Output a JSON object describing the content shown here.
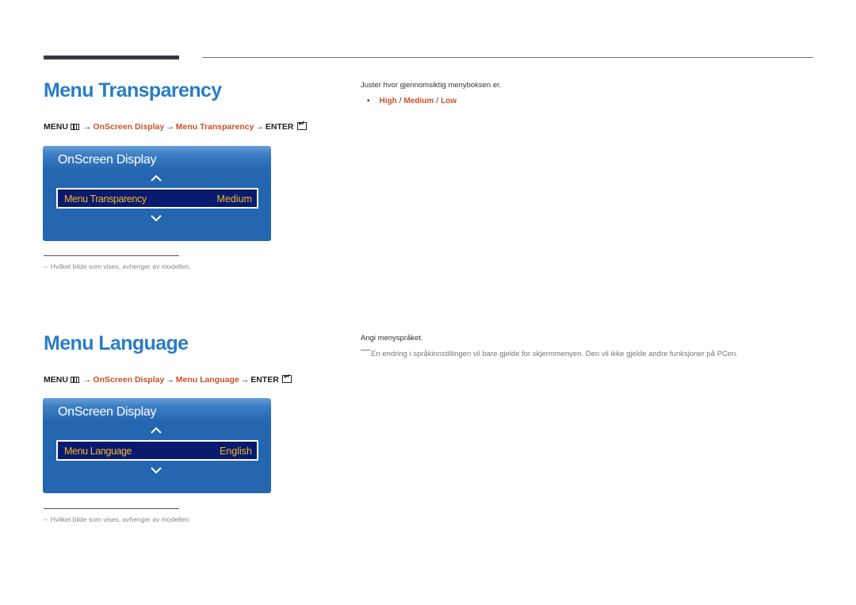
{
  "sections": [
    {
      "title": "Menu Transparency",
      "breadcrumb": {
        "menu": "MENU",
        "path1": "OnScreen Display",
        "path2": "Menu Transparency",
        "enter": "ENTER",
        "arrow": "→"
      },
      "osd": {
        "title": "OnScreen Display",
        "row_label": "Menu Transparency",
        "row_value": "Medium"
      },
      "footnote": "Hvilket bilde som vises, avhenger av modellen.",
      "description": "Juster hvor gjennomsiktig menyboksen er.",
      "options": [
        "High",
        "Medium",
        "Low"
      ],
      "bullet": "•",
      "sep": "/"
    },
    {
      "title": "Menu Language",
      "breadcrumb": {
        "menu": "MENU",
        "path1": "OnScreen Display",
        "path2": "Menu Language",
        "enter": "ENTER",
        "arrow": "→"
      },
      "osd": {
        "title": "OnScreen Display",
        "row_label": "Menu Language",
        "row_value": "English"
      },
      "footnote": "Hvilket bilde som vises, avhenger av modellen.",
      "description": "Angi menyspråket.",
      "note": "En endring i språkinnstillingen vil bare gjelde for skjermmenyen. Den vil ikke gjelde andre funksjoner på PCen."
    }
  ],
  "footnote_dash": "–",
  "colors": {
    "title_blue": "#2a7dc4",
    "link_orange": "#c9502a",
    "osd_blue": "#2566b0",
    "osd_row_bg": "#0a1a6e",
    "osd_text_gold": "#f0b82a"
  }
}
